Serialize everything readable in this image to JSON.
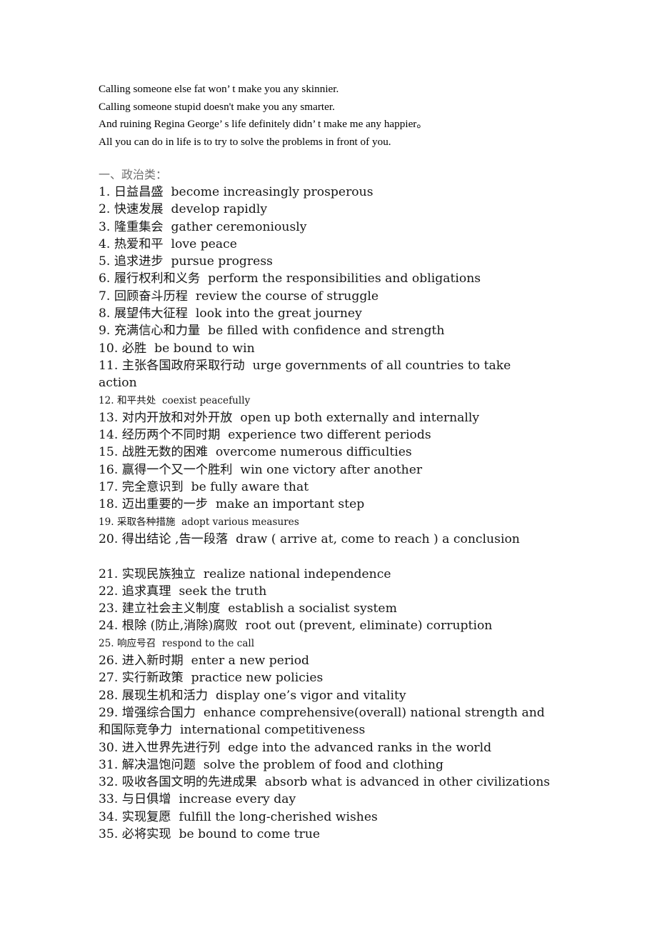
{
  "document": {
    "intro_lines": [
      "Calling someone else fat won’ t make you any skinnier.",
      "Calling someone stupid doesn't make you any smarter.",
      "And ruining Regina George’ s life definitely didn’ t make me any happier。",
      "All you can do in life is to try to solve the problems in front of you."
    ],
    "section_heading": "一、政治类：",
    "items": [
      {
        "num": "1.",
        "cn": "日益昌盛",
        "en": "become increasingly prosperous",
        "size": "normal"
      },
      {
        "num": "2.",
        "cn": "快速发展",
        "en": "develop rapidly",
        "size": "normal"
      },
      {
        "num": "3.",
        "cn": "隆重集会",
        "en": "gather ceremoniously",
        "size": "normal"
      },
      {
        "num": "4.",
        "cn": "热爱和平",
        "en": "love peace",
        "size": "normal"
      },
      {
        "num": "5.",
        "cn": "追求进步",
        "en": "pursue progress",
        "size": "normal"
      },
      {
        "num": "6.",
        "cn": "履行权利和义务",
        "en": "perform the responsibilities and obligations",
        "size": "normal"
      },
      {
        "num": "7.",
        "cn": "回顾奋斗历程",
        "en": "review the course of struggle",
        "size": "normal"
      },
      {
        "num": "8.",
        "cn": "展望伟大征程",
        "en": "look into the great journey",
        "size": "normal"
      },
      {
        "num": "9.",
        "cn": "充满信心和力量",
        "en": "be filled with confidence and strength",
        "size": "normal"
      },
      {
        "num": "10.",
        "cn": "必胜",
        "en": "be bound to win",
        "size": "normal"
      },
      {
        "num": "11.",
        "cn": "主张各国政府采取行动",
        "en": "urge governments of all countries to take",
        "size": "normal",
        "continuation": "action"
      },
      {
        "num": "12.",
        "cn": "和平共处",
        "en": "coexist peacefully",
        "size": "small"
      },
      {
        "num": "13.",
        "cn": "对内开放和对外开放",
        "en": "open up both externally and internally",
        "size": "normal"
      },
      {
        "num": "14.",
        "cn": "经历两个不同时期",
        "en": "experience two different periods",
        "size": "normal"
      },
      {
        "num": "15.",
        "cn": "战胜无数的困难",
        "en": "overcome numerous difficulties",
        "size": "normal"
      },
      {
        "num": "16.",
        "cn": "赢得一个又一个胜利",
        "en": "win one victory after another",
        "size": "normal"
      },
      {
        "num": "17.",
        "cn": "完全意识到",
        "en": "be fully aware that",
        "size": "normal"
      },
      {
        "num": "18.",
        "cn": "迈出重要的一步",
        "en": "make an important step",
        "size": "normal"
      },
      {
        "num": "19.",
        "cn": "采取各种措施",
        "en": "adopt various measures",
        "size": "small"
      },
      {
        "num": "20.",
        "cn": "得出结论 ,告一段落",
        "en": "draw ( arrive at, come to reach ) a conclusion",
        "size": "normal",
        "blank_after": true
      },
      {
        "num": "21.",
        "cn": "实现民族独立",
        "en": "realize national independence",
        "size": "normal"
      },
      {
        "num": "22.",
        "cn": "追求真理",
        "en": "seek the truth",
        "size": "normal"
      },
      {
        "num": "23.",
        "cn": "建立社会主义制度",
        "en": "establish a socialist system",
        "size": "normal"
      },
      {
        "num": "24.",
        "cn": "根除 (防止,消除)腐败",
        "en": "root out (prevent, eliminate) corruption",
        "size": "normal"
      },
      {
        "num": "25.",
        "cn": "响应号召",
        "en": "respond to the call",
        "size": "small"
      },
      {
        "num": "26.",
        "cn": "进入新时期",
        "en": "enter a new period",
        "size": "normal"
      },
      {
        "num": "27.",
        "cn": "实行新政策",
        "en": "practice new policies",
        "size": "normal"
      },
      {
        "num": "28.",
        "cn": "展现生机和活力",
        "en": "display one’s vigor and vitality",
        "size": "normal"
      },
      {
        "num": "29.",
        "cn": "增强综合国力",
        "en": "enhance comprehensive(overall) national strength and",
        "size": "normal",
        "continuation": "和国际竞争力  international competitiveness"
      },
      {
        "num": "30.",
        "cn": "进入世界先进行列",
        "en": "edge into the advanced ranks in the world",
        "size": "normal"
      },
      {
        "num": "31.",
        "cn": "解决温饱问题",
        "en": "solve the problem of food and clothing",
        "size": "normal"
      },
      {
        "num": "32.",
        "cn": "吸收各国文明的先进成果",
        "en": "absorb what is advanced in other civilizations",
        "size": "normal"
      },
      {
        "num": "33.",
        "cn": "与日俱增",
        "en": "increase every day",
        "size": "normal"
      },
      {
        "num": "34.",
        "cn": "实现复愿",
        "en": "fulfill the long-cherished wishes",
        "size": "normal"
      },
      {
        "num": "35.",
        "cn": "必将实现",
        "en": "be bound to come true",
        "size": "normal"
      }
    ]
  }
}
